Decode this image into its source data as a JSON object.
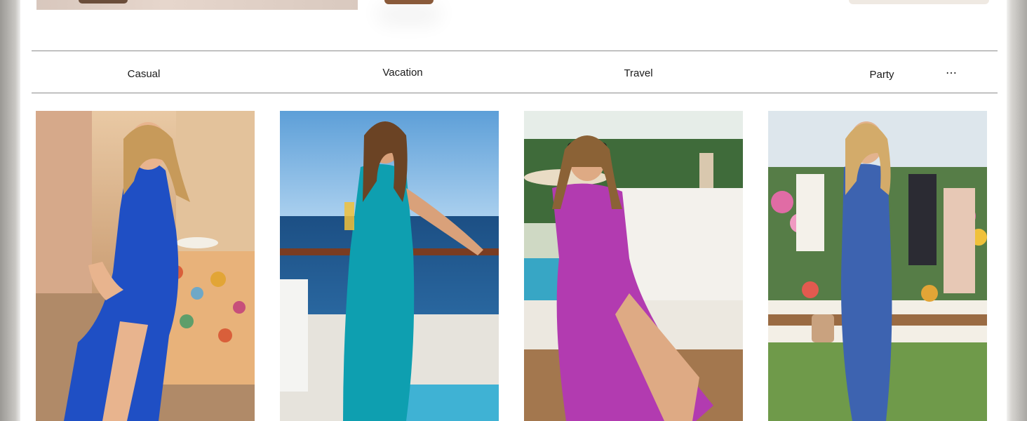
{
  "tabs": [
    {
      "label": "Casual"
    },
    {
      "label": "Vacation"
    },
    {
      "label": "Travel"
    },
    {
      "label": "Party"
    }
  ],
  "more_icon": "ellipsis-icon",
  "colors": {
    "casual_dress": "#1f4fc4",
    "vacation_dress": "#0e9fb0",
    "travel_dress": "#b23bb0",
    "party_dress": "#3d63b0"
  }
}
